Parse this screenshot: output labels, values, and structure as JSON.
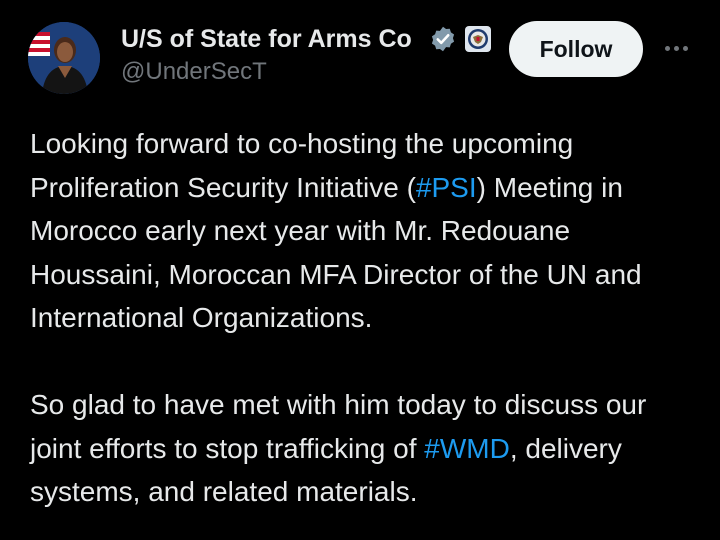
{
  "author": {
    "display_name": "U/S of State for Arms Co",
    "handle": "@UnderSecT"
  },
  "icons": {
    "verified": "verified-badge-icon",
    "affiliation": "state-department-seal-icon",
    "more": "more-options-icon"
  },
  "follow_button": {
    "label": "Follow"
  },
  "tweet": {
    "p1_part1": "Looking forward to co-hosting the upcoming Proliferation Security Initiative (",
    "p1_hashtag": "#PSI",
    "p1_part2": ") Meeting in Morocco early next year with Mr. Redouane Houssaini, Moroccan MFA Director of the UN and International Organizations.",
    "p2_part1": "So glad to have met with him today to discuss our joint efforts to stop trafficking of ",
    "p2_hashtag": "#WMD",
    "p2_part2": ", delivery systems, and related materials."
  },
  "colors": {
    "background": "#000000",
    "text": "#e7e9ea",
    "secondary_text": "#71767b",
    "link": "#1d9bf0",
    "button_bg": "#eff3f4"
  }
}
